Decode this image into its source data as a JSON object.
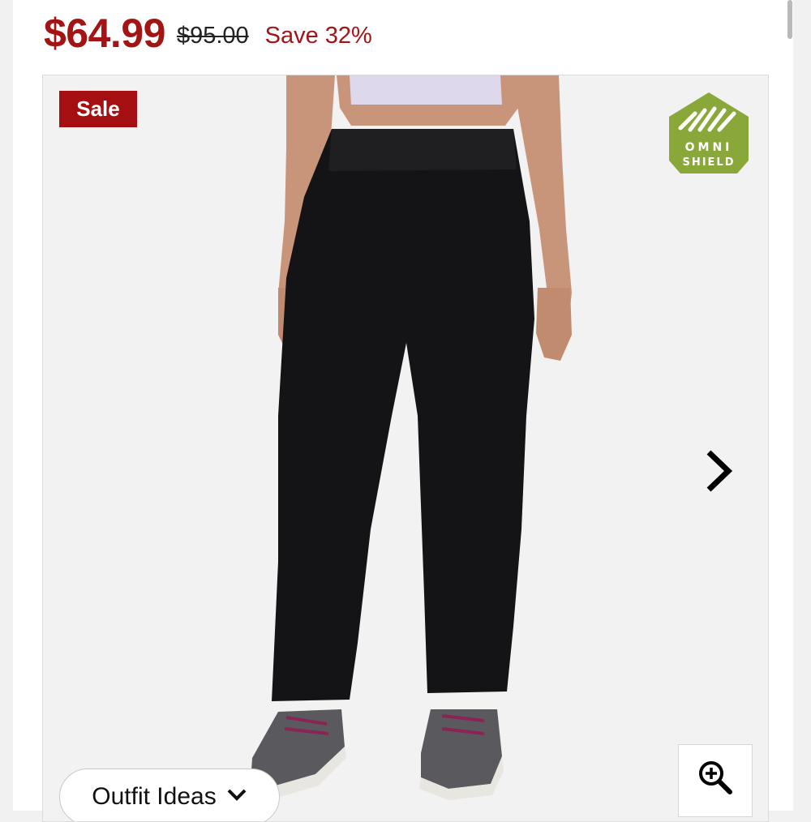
{
  "price": {
    "current": "$64.99",
    "original": "$95.00",
    "savings": "Save 32%"
  },
  "gallery": {
    "badge": "Sale",
    "technology_logo": {
      "line1": "OMNI",
      "line2": "SHIELD",
      "color": "#8aa83a"
    },
    "next_icon": "chevron-right-icon",
    "zoom_icon": "zoom-in-icon"
  },
  "outfit_button": {
    "label": "Outfit Ideas",
    "icon": "chevron-down-icon"
  },
  "colors": {
    "sale_red": "#a31515",
    "badge_red": "#a50f12",
    "logo_green": "#8aa83a"
  }
}
